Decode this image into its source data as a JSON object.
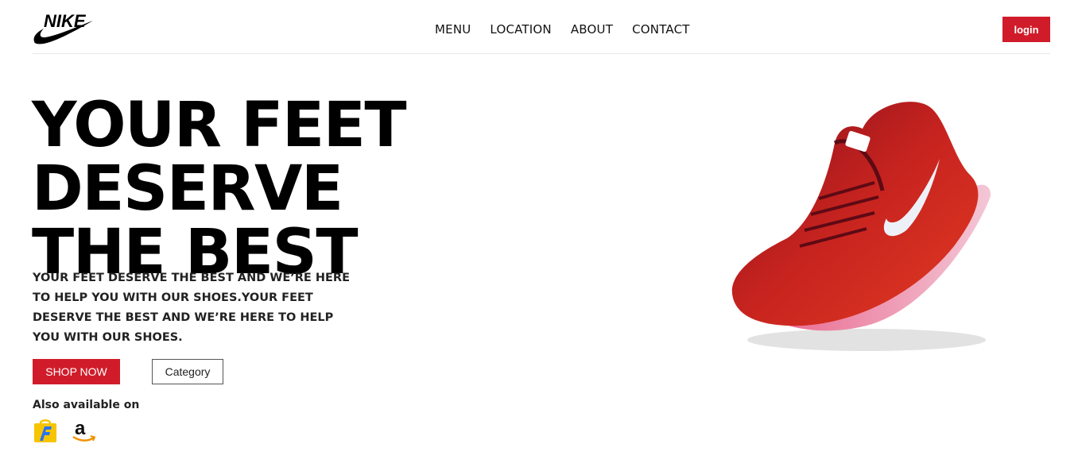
{
  "header": {
    "brand": "NIKE",
    "nav": [
      {
        "label": "MENU"
      },
      {
        "label": "LOCATION"
      },
      {
        "label": "ABOUT"
      },
      {
        "label": "CONTACT"
      }
    ],
    "login_label": "login"
  },
  "hero": {
    "title_line1": "YOUR FEET DESERVE",
    "title_line2": "THE BEST",
    "description": "YOUR FEET DESERVE THE BEST AND WE’RE HERE TO HELP YOU WITH OUR SHOES.YOUR FEET DESERVE THE BEST AND WE’RE HERE TO HELP YOU WITH OUR SHOES.",
    "shop_label": "SHOP NOW",
    "category_label": "Category",
    "also_label": "Also available on"
  },
  "colors": {
    "accent": "#d01c2a",
    "text": "#111111"
  },
  "icons": [
    "nike-logo-icon",
    "flipkart-icon",
    "amazon-icon",
    "shoe-image"
  ]
}
